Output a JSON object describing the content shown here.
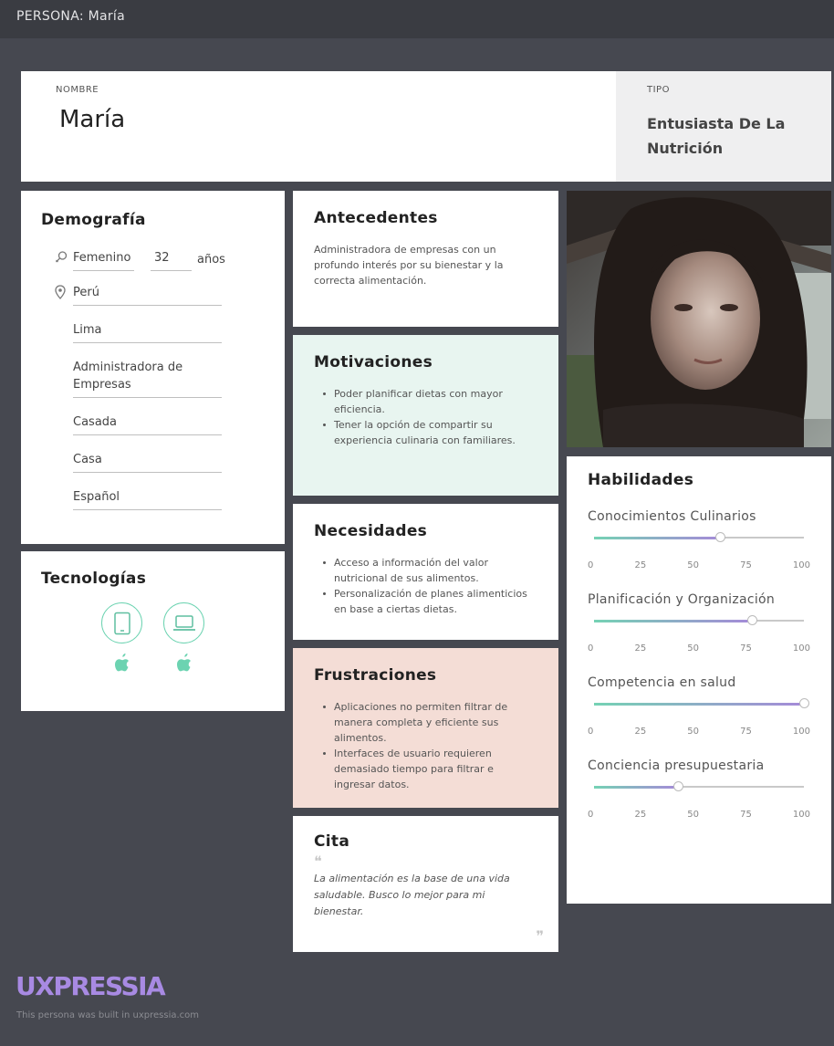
{
  "topbar": {
    "title": "PERSONA: María"
  },
  "header": {
    "name_label": "NOMBRE",
    "name": "María",
    "type_label": "TIPO",
    "type": "Entusiasta De La Nutrición"
  },
  "demographics": {
    "title": "Demografía",
    "gender": "Femenino",
    "age": "32",
    "age_unit": "años",
    "country": "Perú",
    "city": "Lima",
    "occupation": "Administradora de Empresas",
    "marital_status": "Casada",
    "residence": "Casa",
    "language": "Español"
  },
  "technologies": {
    "title": "Tecnologías",
    "devices": [
      {
        "icon": "tablet-icon",
        "platform": "apple-icon"
      },
      {
        "icon": "laptop-icon",
        "platform": "apple-icon"
      }
    ]
  },
  "background": {
    "title": "Antecedentes",
    "text": "Administradora de empresas con un profundo interés por su bienestar y la correcta alimentación."
  },
  "motivations": {
    "title": "Motivaciones",
    "items": [
      "Poder planificar dietas con mayor eficiencia.",
      "Tener la opción de compartir su experiencia culinaria con familiares."
    ]
  },
  "needs": {
    "title": "Necesidades",
    "items": [
      "Acceso a información del valor nutricional de sus alimentos.",
      "Personalización de planes alimenticios en base a ciertas dietas."
    ]
  },
  "frustrations": {
    "title": "Frustraciones",
    "items": [
      "Aplicaciones no permiten filtrar de manera completa y eficiente sus alimentos.",
      "Interfaces de usuario requieren demasiado tiempo para filtrar e ingresar datos."
    ]
  },
  "quote": {
    "title": "Cita",
    "open_mark": "❝",
    "text": "La alimentación es la base de una vida saludable. Busco lo mejor para mi bienestar.",
    "close_mark": "❞"
  },
  "skills": {
    "title": "Habilidades",
    "scale": [
      "0",
      "25",
      "50",
      "75",
      "100"
    ],
    "items": [
      {
        "name": "Conocimientos Culinarios",
        "value": 60
      },
      {
        "name": "Planificación y Organización",
        "value": 75
      },
      {
        "name": "Competencia en salud",
        "value": 100
      },
      {
        "name": "Conciencia presupuestaria",
        "value": 40
      }
    ]
  },
  "colors": {
    "background": "#464850",
    "mint": "#6cd3b1",
    "lilac": "#a58ad8",
    "motivations_bg": "#e8f5f0",
    "frustrations_bg": "#f4ddd6",
    "logo": "#a88ae3"
  },
  "footer": {
    "logo": "UXPRESSIA",
    "built_text": "This persona was built in uxpressia.com"
  }
}
